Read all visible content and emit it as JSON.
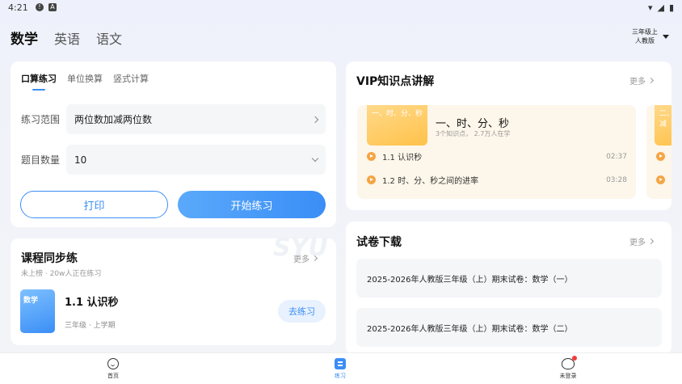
{
  "status": {
    "time": "4:21"
  },
  "subjects": [
    "数学",
    "英语",
    "语文"
  ],
  "grade": {
    "line1": "三年级上",
    "line2": "人教版"
  },
  "practice": {
    "tabs": [
      "口算练习",
      "单位换算",
      "竖式计算"
    ],
    "range_label": "练习范围",
    "range_value": "两位数加减两位数",
    "count_label": "题目数量",
    "count_value": "10",
    "print_label": "打印",
    "start_label": "开始练习"
  },
  "course": {
    "title": "课程同步练",
    "subtitle": "未上榜 · 20w人正在练习",
    "more": "更多",
    "cover_label": "数学",
    "lesson_title": "1.1 认识秒",
    "lesson_meta": "三年级 · 上学期",
    "go_label": "去练习",
    "watermark": "SYU"
  },
  "vip": {
    "title": "VIP知识点讲解",
    "more": "更多",
    "topic": {
      "thumb": "一、时、分、秒",
      "title": "一、时、分、秒",
      "meta": "3个知识点， 2.7万人在学",
      "videos": [
        {
          "title": "1.1 认识秒",
          "duration": "02:37"
        },
        {
          "title": "1.2 时、分、秒之间的进率",
          "duration": "03:28"
        }
      ]
    },
    "next_thumb": "二、加减"
  },
  "papers": {
    "title": "试卷下载",
    "more": "更多",
    "items": [
      "2025-2026年人教版三年级（上）期末试卷：数学（一）",
      "2025-2026年人教版三年级（上）期末试卷：数学（二）"
    ]
  },
  "nav": [
    "首页",
    "练习",
    "未登录"
  ],
  "colors": {
    "accent": "#3a8ef6",
    "orange": "#f5a545"
  }
}
